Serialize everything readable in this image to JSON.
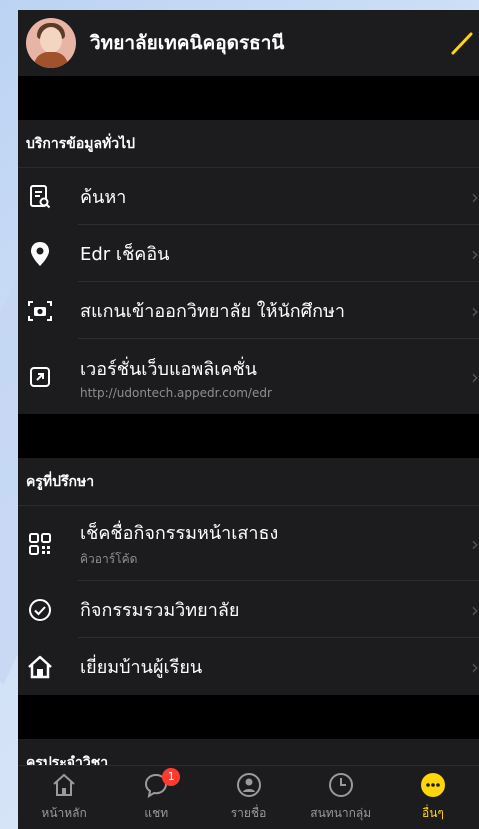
{
  "header": {
    "title": "วิทยาลัยเทคนิคอุดรธานี",
    "avatar_icon": "user-avatar",
    "edit_icon": "pencil-icon"
  },
  "sections": [
    {
      "title": "บริการข้อมูลทั่วไป",
      "items": [
        {
          "label": "ค้นหา",
          "icon": "search-document-icon"
        },
        {
          "label": "Edr เช็คอิน",
          "icon": "location-pin-icon"
        },
        {
          "label": "สแกนเข้าออกวิทยาลัย ให้นักศึกษา",
          "icon": "scan-camera-icon"
        },
        {
          "label": "เวอร์ชั่นเว็บแอพลิเคชั่น",
          "sub": "http://udontech.appedr.com/edr",
          "icon": "external-link-icon"
        }
      ]
    },
    {
      "title": "ครูที่ปรึกษา",
      "items": [
        {
          "label": "เช็คชื่อกิจกรรมหน้าเสาธง",
          "sub": "คิวอาร์โค้ด",
          "icon": "qr-code-icon"
        },
        {
          "label": "กิจกรรมรวมวิทยาลัย",
          "icon": "check-circle-icon"
        },
        {
          "label": "เยี่ยมบ้านผู้เรียน",
          "icon": "home-icon"
        }
      ]
    },
    {
      "title": "ครูประจำวิชา",
      "items": []
    }
  ],
  "tabbar": {
    "tabs": [
      {
        "label": "หน้าหลัก",
        "icon": "home-tab-icon"
      },
      {
        "label": "แชท",
        "icon": "chat-bubble-icon",
        "badge": "1"
      },
      {
        "label": "รายชื่อ",
        "icon": "contacts-icon"
      },
      {
        "label": "สนทนากลุ่ม",
        "icon": "clock-icon"
      },
      {
        "label": "อื่นๆ",
        "icon": "more-icon",
        "active": true
      }
    ]
  },
  "colors": {
    "accent": "#ffd60a",
    "badge": "#ff3b30",
    "surface": "#1c1c1e",
    "background": "#000000"
  }
}
